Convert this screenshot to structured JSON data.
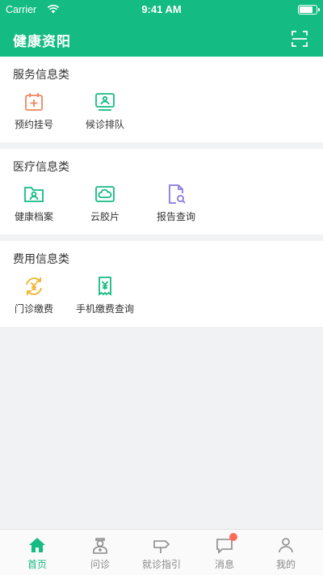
{
  "status_bar": {
    "carrier": "Carrier",
    "time": "9:41 AM",
    "battery_level": 0.9
  },
  "app_bar": {
    "title": "健康资阳",
    "scan_icon": "scan-icon"
  },
  "sections": [
    {
      "title": "服务信息类",
      "items": [
        {
          "label": "预约挂号",
          "icon": "calendar-plus-icon",
          "color": "#f0855c"
        },
        {
          "label": "候诊排队",
          "icon": "queue-monitor-icon",
          "color": "#14bb82"
        }
      ]
    },
    {
      "title": "医疗信息类",
      "items": [
        {
          "label": "健康档案",
          "icon": "health-folder-icon",
          "color": "#14bb82"
        },
        {
          "label": "云胶片",
          "icon": "cloud-film-icon",
          "color": "#14bb82"
        },
        {
          "label": "报告查询",
          "icon": "report-search-icon",
          "color": "#8a78e0"
        }
      ]
    },
    {
      "title": "费用信息类",
      "items": [
        {
          "label": "门诊缴费",
          "icon": "yuan-refresh-icon",
          "color": "#f0b22a"
        },
        {
          "label": "手机缴费查询",
          "icon": "receipt-yuan-icon",
          "color": "#14bb82"
        }
      ]
    }
  ],
  "tab_bar": {
    "active_color": "#14bb82",
    "inactive_color": "#8a8a8a",
    "items": [
      {
        "label": "首页",
        "icon": "home-icon",
        "active": true
      },
      {
        "label": "问诊",
        "icon": "doctor-icon",
        "active": false
      },
      {
        "label": "就诊指引",
        "icon": "guide-icon",
        "active": false
      },
      {
        "label": "消息",
        "icon": "message-icon",
        "active": false,
        "badge": true
      },
      {
        "label": "我的",
        "icon": "profile-icon",
        "active": false
      }
    ]
  }
}
